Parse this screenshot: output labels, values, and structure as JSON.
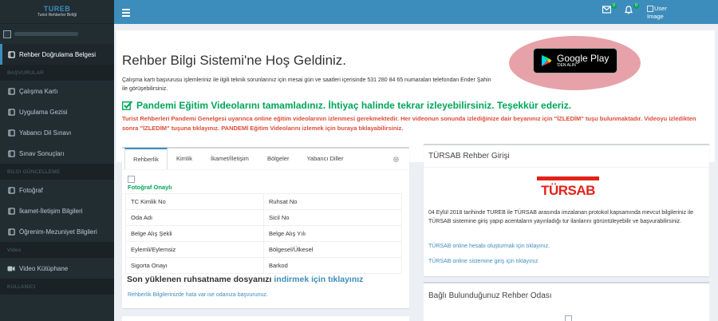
{
  "brand": {
    "logo_text": "TUREB",
    "logo_subtitle": "Turist Rehberler Birliği"
  },
  "sidebar": {
    "items": [
      {
        "label": "Rehber Doğrulama Belgesi",
        "active": true
      },
      {
        "header": "BAŞVURULAR"
      },
      {
        "label": "Çalışma Kartı"
      },
      {
        "label": "Uygulama Gezisi"
      },
      {
        "label": "Yabancı Dil Sınavı"
      },
      {
        "label": "Sınav Sonuçları"
      },
      {
        "header": "BILGI GÜNCELLEME"
      },
      {
        "label": "Fotoğraf"
      },
      {
        "label": "İkamet-İletişim Bilgileri"
      },
      {
        "label": "Öğrenim-Mezuniyet Bilgileri"
      },
      {
        "header": "Video"
      },
      {
        "label": "Video Kütüphane"
      },
      {
        "header": "KULLANICI"
      }
    ]
  },
  "topbar": {
    "mail_badge": "0",
    "bell_badge": "0",
    "user_image_alt": "User Image"
  },
  "hero": {
    "title": "Rehber Bilgi Sistemi'ne Hoş Geldiniz.",
    "text": "Çalışma kartı başvurusu işlemleriniz ile ilgili teknik sorunlarınız için mesai gün ve saatleri içerisinde 531 280 84 65 numaraları telefondan Ender Şahin ile görüşebilirsiniz.",
    "google_play_big": "Google Play",
    "google_play_small": "'DEN ALIN",
    "success": "Pandemi Eğitim Videolarını tamamladınız. İhtiyaç halinde tekrar izleyebilirsiniz. Teşekkür ederiz.",
    "warning": "Turist Rehberleri Pandemi Genelgesi uyarınca online eğitim videolarının izlenmesi gerekmektedir. Her videonun sonunda izlediğinize dair beyanınız için \"İZLEDİM\" tuşu bulunmaktadır. Videoyu izledikten sonra \"İZLEDİM\" tuşuna tıklayınız. PANDEMİ Eğitim Videolarını izlemek için buraya tıklayabilirsiniz."
  },
  "profile": {
    "tabs": [
      "Rehberlik",
      "Kimlik",
      "İkamet/İletişim",
      "Bölgeler",
      "Yabancı Diller"
    ],
    "photo_label": "Fotoğraf Onaylı",
    "rows": [
      [
        "TC Kimlik No",
        "Ruhsat No"
      ],
      [
        "Oda Adı",
        "Sicil No"
      ],
      [
        "Belge Alış Şekli",
        "Belge Alış Yılı"
      ],
      [
        "Eylemli/Eylemsiz",
        "Bölgesel/Ülkesel"
      ],
      [
        "Sigorta Onayı",
        "Barkod"
      ]
    ],
    "license_text": "Son yüklenen ruhsatname dosyanızı ",
    "license_link": "indirmek için tıklayınız",
    "error_link": "Rehberlik Bilgilerinizde hata var ise odanıza başvurunuz."
  },
  "tursab": {
    "title": "TÜRSAB Rehber Girişi",
    "logo_text": "TÜRSAB",
    "text": "04 Eylül 2018 tarihinde TUREB ile TÜRSAB arasında imzalanan protokol kapsamında mevcut bilgileriniz ile TÜRSAB sistemine giriş yapıp acentaların yayınladığı tur ilanlarını görüntüleyebilir ve başvurabilirsiniz.",
    "link1": "TÜRSAB online hesabı oluşturmak için tıklayınız.",
    "link2": "TÜRSAB online sistemine giriş için tıklayınız"
  },
  "room": {
    "title": "Bağlı Bulunduğunuz Rehber Odası"
  },
  "colors": {
    "sidebar_bg": "#222d32",
    "topbar_bg": "#3c8dbc",
    "success": "#00a65a",
    "warning": "#dd4b39",
    "tursab_red": "#e2231a"
  }
}
